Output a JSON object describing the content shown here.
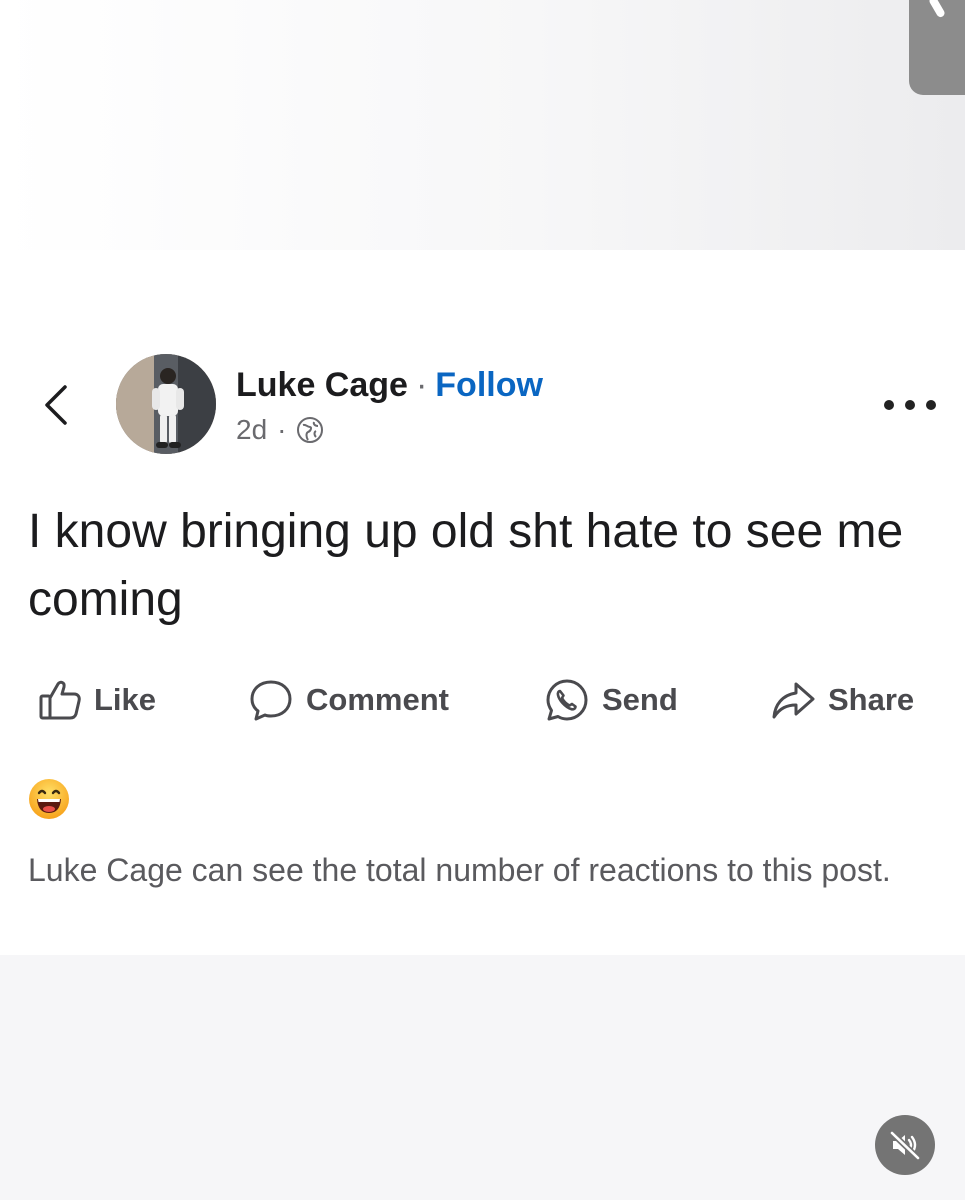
{
  "post": {
    "author_name": "Luke Cage",
    "separator": "·",
    "follow_label": "Follow",
    "timestamp": "2d",
    "meta_separator": "·",
    "audience_icon": "globe-icon",
    "text": "I know bringing up old sht hate to see me coming"
  },
  "actions": [
    {
      "label": "Like",
      "icon": "thumbs-up-icon"
    },
    {
      "label": "Comment",
      "icon": "comment-bubble-icon"
    },
    {
      "label": "Send",
      "icon": "whatsapp-icon"
    },
    {
      "label": "Share",
      "icon": "share-arrow-icon"
    }
  ],
  "reaction": {
    "icon": "laughing-emoji-icon"
  },
  "notice": "Luke Cage can see the total number of reactions to this post.",
  "colors": {
    "follow": "#0a66c2",
    "text": "#1c1c1e",
    "secondary": "#5a5a5e",
    "background": "#f6f6f8"
  }
}
